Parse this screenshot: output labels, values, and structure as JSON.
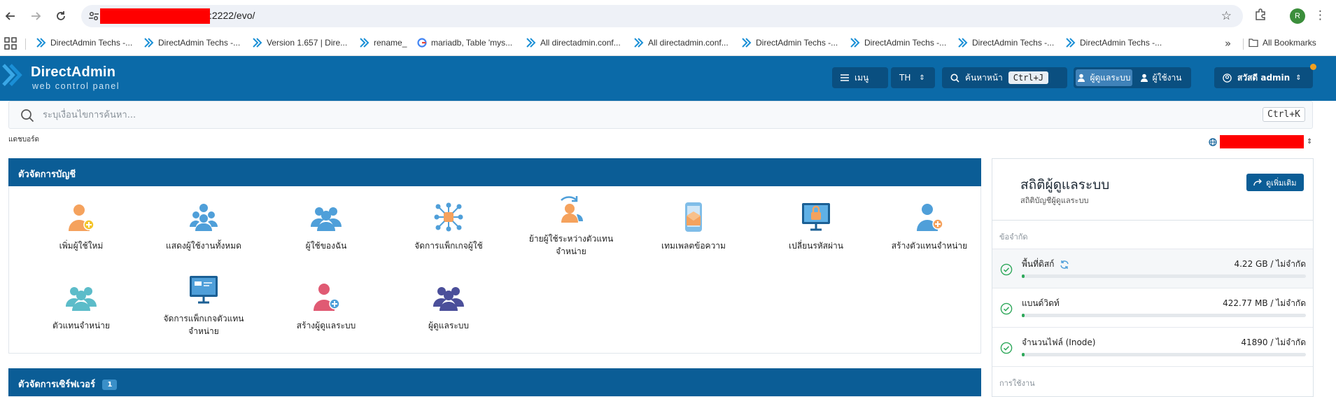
{
  "browser": {
    "url_suffix": ":2222/evo/",
    "profile_initial": "R",
    "bookmarks": [
      "DirectAdmin Techs -...",
      "DirectAdmin Techs -...",
      "Version 1.657 | Dire...",
      "rename_",
      "mariadb, Table 'mys...",
      "All directadmin.conf...",
      "All directadmin.conf...",
      "DirectAdmin Techs -...",
      "DirectAdmin Techs -...",
      "DirectAdmin Techs -...",
      "DirectAdmin Techs -..."
    ],
    "all_bookmarks": "All Bookmarks"
  },
  "header": {
    "logo_title": "DirectAdmin",
    "logo_sub": "web control panel",
    "menu_label": "เมนู",
    "lang": "TH",
    "search_label": "ค้นหาหน้า",
    "search_kbd": "Ctrl+J",
    "role_admin": "ผู้ดูแลระบบ",
    "role_user": "ผู้ใช้งาน",
    "greeting": "สวัสดี admin"
  },
  "search": {
    "placeholder": "ระบุเงื่อนไขการค้นหา...",
    "kbd": "Ctrl+K"
  },
  "breadcrumb": "แดชบอร์ด",
  "account_manager": {
    "title": "ตัวจัดการบัญชี",
    "items": [
      {
        "label": "เพิ่มผู้ใช้ใหม่",
        "icon": "add-user-icon"
      },
      {
        "label": "แสดงผู้ใช้งานทั้งหมด",
        "icon": "users-group-icon"
      },
      {
        "label": "ผู้ใช้ของฉัน",
        "icon": "my-users-icon"
      },
      {
        "label": "จัดการแพ็กเกจผู้ใช้",
        "icon": "package-network-icon"
      },
      {
        "label": "ย้ายผู้ใช้ระหว่างตัวแทนจำหน่าย",
        "icon": "transfer-user-icon"
      },
      {
        "label": "เทมเพลตข้อความ",
        "icon": "message-template-icon"
      },
      {
        "label": "เปลี่ยนรหัสผ่าน",
        "icon": "lock-monitor-icon"
      },
      {
        "label": "สร้างตัวแทนจำหน่าย",
        "icon": "create-reseller-icon"
      },
      {
        "label": "ตัวแทนจำหน่าย",
        "icon": "resellers-icon"
      },
      {
        "label": "จัดการแพ็กเกจตัวแทนจำหน่าย",
        "icon": "reseller-package-icon"
      },
      {
        "label": "สร้างผู้ดูแลระบบ",
        "icon": "create-admin-icon"
      },
      {
        "label": "ผู้ดูแลระบบ",
        "icon": "admins-icon"
      }
    ]
  },
  "server_manager": {
    "title": "ตัวจัดการเซิร์ฟเวอร์",
    "badge": "1"
  },
  "stats": {
    "title": "สถิติผู้ดูแลระบบ",
    "subtitle": "สถิติบัญชีผู้ดูแลระบบ",
    "more_label": "ดูเพิ่มเติม",
    "limits_label": "ข้อจำกัด",
    "usage_label": "การใช้งาน",
    "rows": [
      {
        "label": "พื้นที่ดิสก์",
        "value": "4.22 GB / ไม่จำกัด",
        "fraction": 0.01
      },
      {
        "label": "แบนด์วิดท์",
        "value": "422.77 MB / ไม่จำกัด",
        "fraction": 0.01
      },
      {
        "label": "จำนวนไฟล์ (Inode)",
        "value": "41890 / ไม่จำกัด",
        "fraction": 0.01
      }
    ],
    "accent": "#2ea85a"
  }
}
